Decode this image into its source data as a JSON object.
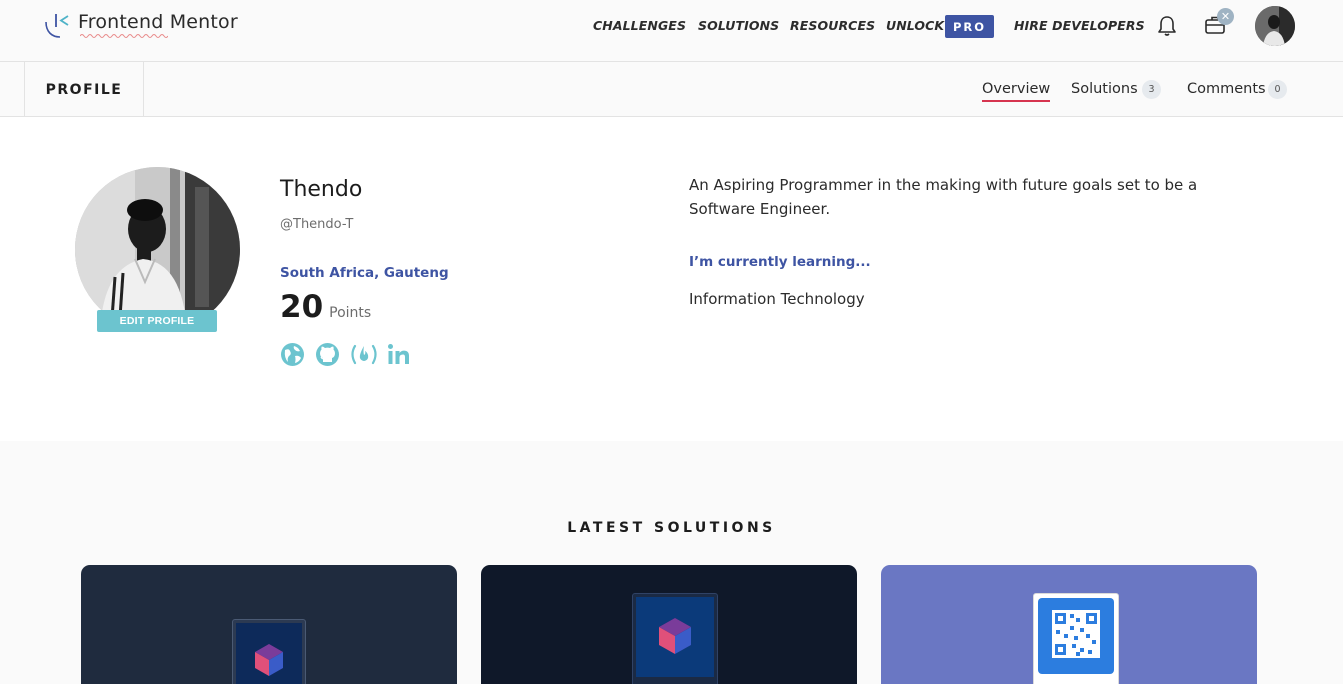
{
  "app": {
    "logo_text": "Frontend Mentor"
  },
  "nav": {
    "challenges": "CHALLENGES",
    "solutions": "SOLUTIONS",
    "resources": "RESOURCES",
    "unlock": "UNLOCK",
    "pro": "PRO",
    "hire": "HIRE DEVELOPERS"
  },
  "subnav": {
    "profile": "PROFILE",
    "overview": "Overview",
    "solutions": "Solutions",
    "solutions_count": "3",
    "comments": "Comments",
    "comments_count": "0"
  },
  "profile": {
    "edit_label": "EDIT PROFILE",
    "name": "Thendo",
    "handle": "@Thendo-T",
    "location": "South Africa, Gauteng",
    "points": "20",
    "points_label": "Points",
    "bio": "An Aspiring Programmer in the making with future goals set to be a Software Engineer.",
    "learning_heading": "I’m currently learning...",
    "learning_value": "Information Technology",
    "social_icons": [
      "globe-icon",
      "github-icon",
      "freecodecamp-icon",
      "linkedin-icon"
    ]
  },
  "latest": {
    "title": "LATEST SOLUTIONS",
    "cards": [
      {
        "bg": "#1f2b3e"
      },
      {
        "bg": "#0f1829"
      },
      {
        "bg": "#6a77c3"
      }
    ]
  },
  "colors": {
    "accent_blue": "#3e54a3",
    "teal": "#6cc4cf",
    "active_underline": "#d6344f"
  }
}
